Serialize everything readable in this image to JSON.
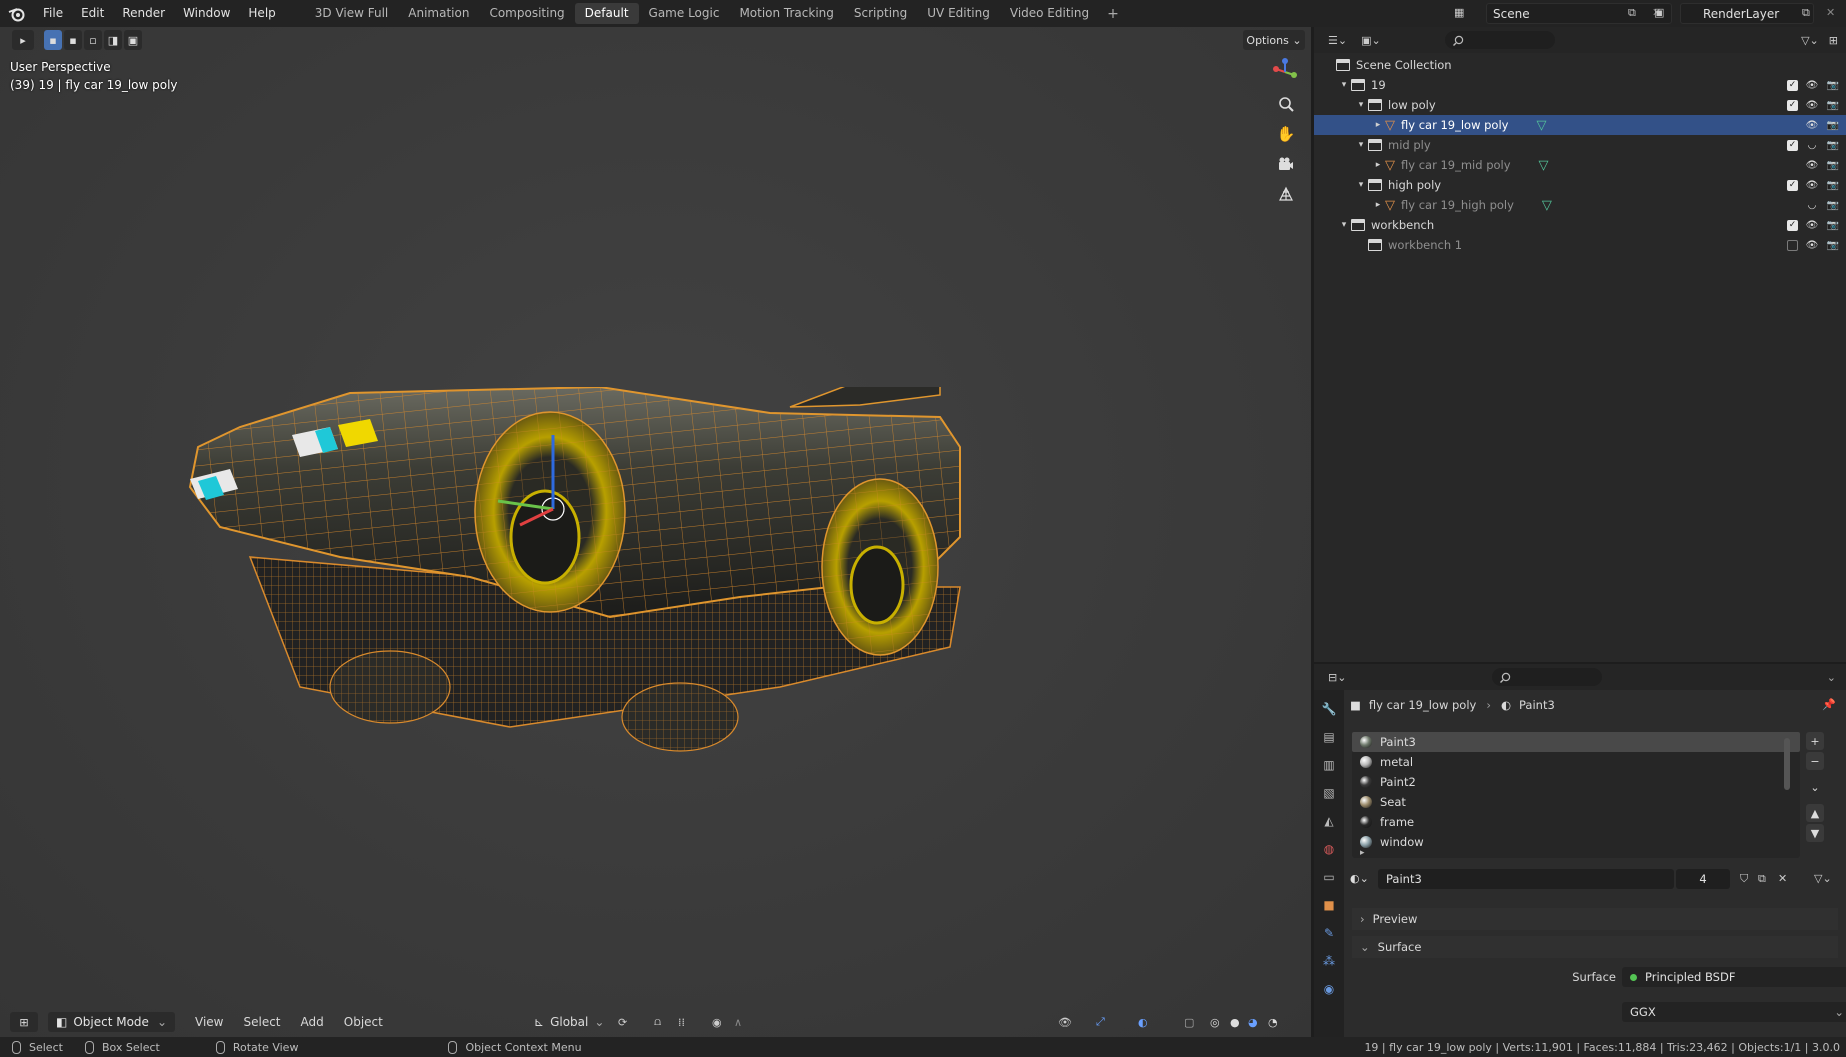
{
  "topbar": {
    "menus": [
      "File",
      "Edit",
      "Render",
      "Window",
      "Help"
    ],
    "workspaces": [
      "3D View Full",
      "Animation",
      "Compositing",
      "Default",
      "Game Logic",
      "Motion Tracking",
      "Scripting",
      "UV Editing",
      "Video Editing"
    ],
    "active_workspace": "Default",
    "scene": "Scene",
    "render_layer": "RenderLayer"
  },
  "viewport": {
    "perspective": "User Perspective",
    "object_info": "(39) 19 | fly car 19_low poly",
    "options_label": "Options",
    "mode": "Object Mode",
    "menus": [
      "View",
      "Select",
      "Add",
      "Object"
    ],
    "orientation": "Global"
  },
  "outliner": {
    "root": "Scene Collection",
    "rows": [
      {
        "label": "19",
        "depth": 1,
        "kind": "collection",
        "expanded": true,
        "checked": true,
        "visible": true
      },
      {
        "label": "low poly",
        "depth": 2,
        "kind": "collection",
        "expanded": true,
        "checked": true,
        "visible": true
      },
      {
        "label": "fly car 19_low poly",
        "depth": 3,
        "kind": "mesh",
        "selected": true,
        "visible": true
      },
      {
        "label": "mid ply",
        "depth": 2,
        "kind": "collection",
        "expanded": true,
        "checked": true,
        "visible": false,
        "dim": true
      },
      {
        "label": "fly car 19_mid poly",
        "depth": 3,
        "kind": "mesh",
        "visible": true,
        "dim": true
      },
      {
        "label": "high poly",
        "depth": 2,
        "kind": "collection",
        "expanded": true,
        "checked": true,
        "visible": true
      },
      {
        "label": "fly car 19_high poly",
        "depth": 3,
        "kind": "mesh",
        "visible": false,
        "dim": true
      },
      {
        "label": "workbench",
        "depth": 1,
        "kind": "collection",
        "expanded": true,
        "checked": true,
        "visible": true
      },
      {
        "label": "workbench 1",
        "depth": 2,
        "kind": "collection",
        "checked": false,
        "visible": true,
        "dim": true
      }
    ]
  },
  "properties": {
    "breadcrumb_object": "fly car 19_low poly",
    "breadcrumb_material": "Paint3",
    "materials": [
      {
        "name": "Paint3",
        "color": "#6f7a6c",
        "active": true
      },
      {
        "name": "metal",
        "color": "#b8b8b8"
      },
      {
        "name": "Paint2",
        "color": "#3c3c3c"
      },
      {
        "name": "Seat",
        "color": "#9a8a6a"
      },
      {
        "name": "frame",
        "color": "#2a2a2a"
      },
      {
        "name": "window",
        "color": "#8aa0a8"
      }
    ],
    "material_name": "Paint3",
    "user_count": "4",
    "preview_label": "Preview",
    "surface_section": "Surface",
    "surface_label": "Surface",
    "surface_value": "Principled BSDF",
    "distribution": "GGX"
  },
  "statusbar": {
    "select": "Select",
    "box_select": "Box Select",
    "rotate_view": "Rotate View",
    "context_menu": "Object Context Menu",
    "stats": "19 | fly car 19_low poly | Verts:11,901 | Faces:11,884 | Tris:23,462 | Objects:1/1 | 3.0.0"
  }
}
